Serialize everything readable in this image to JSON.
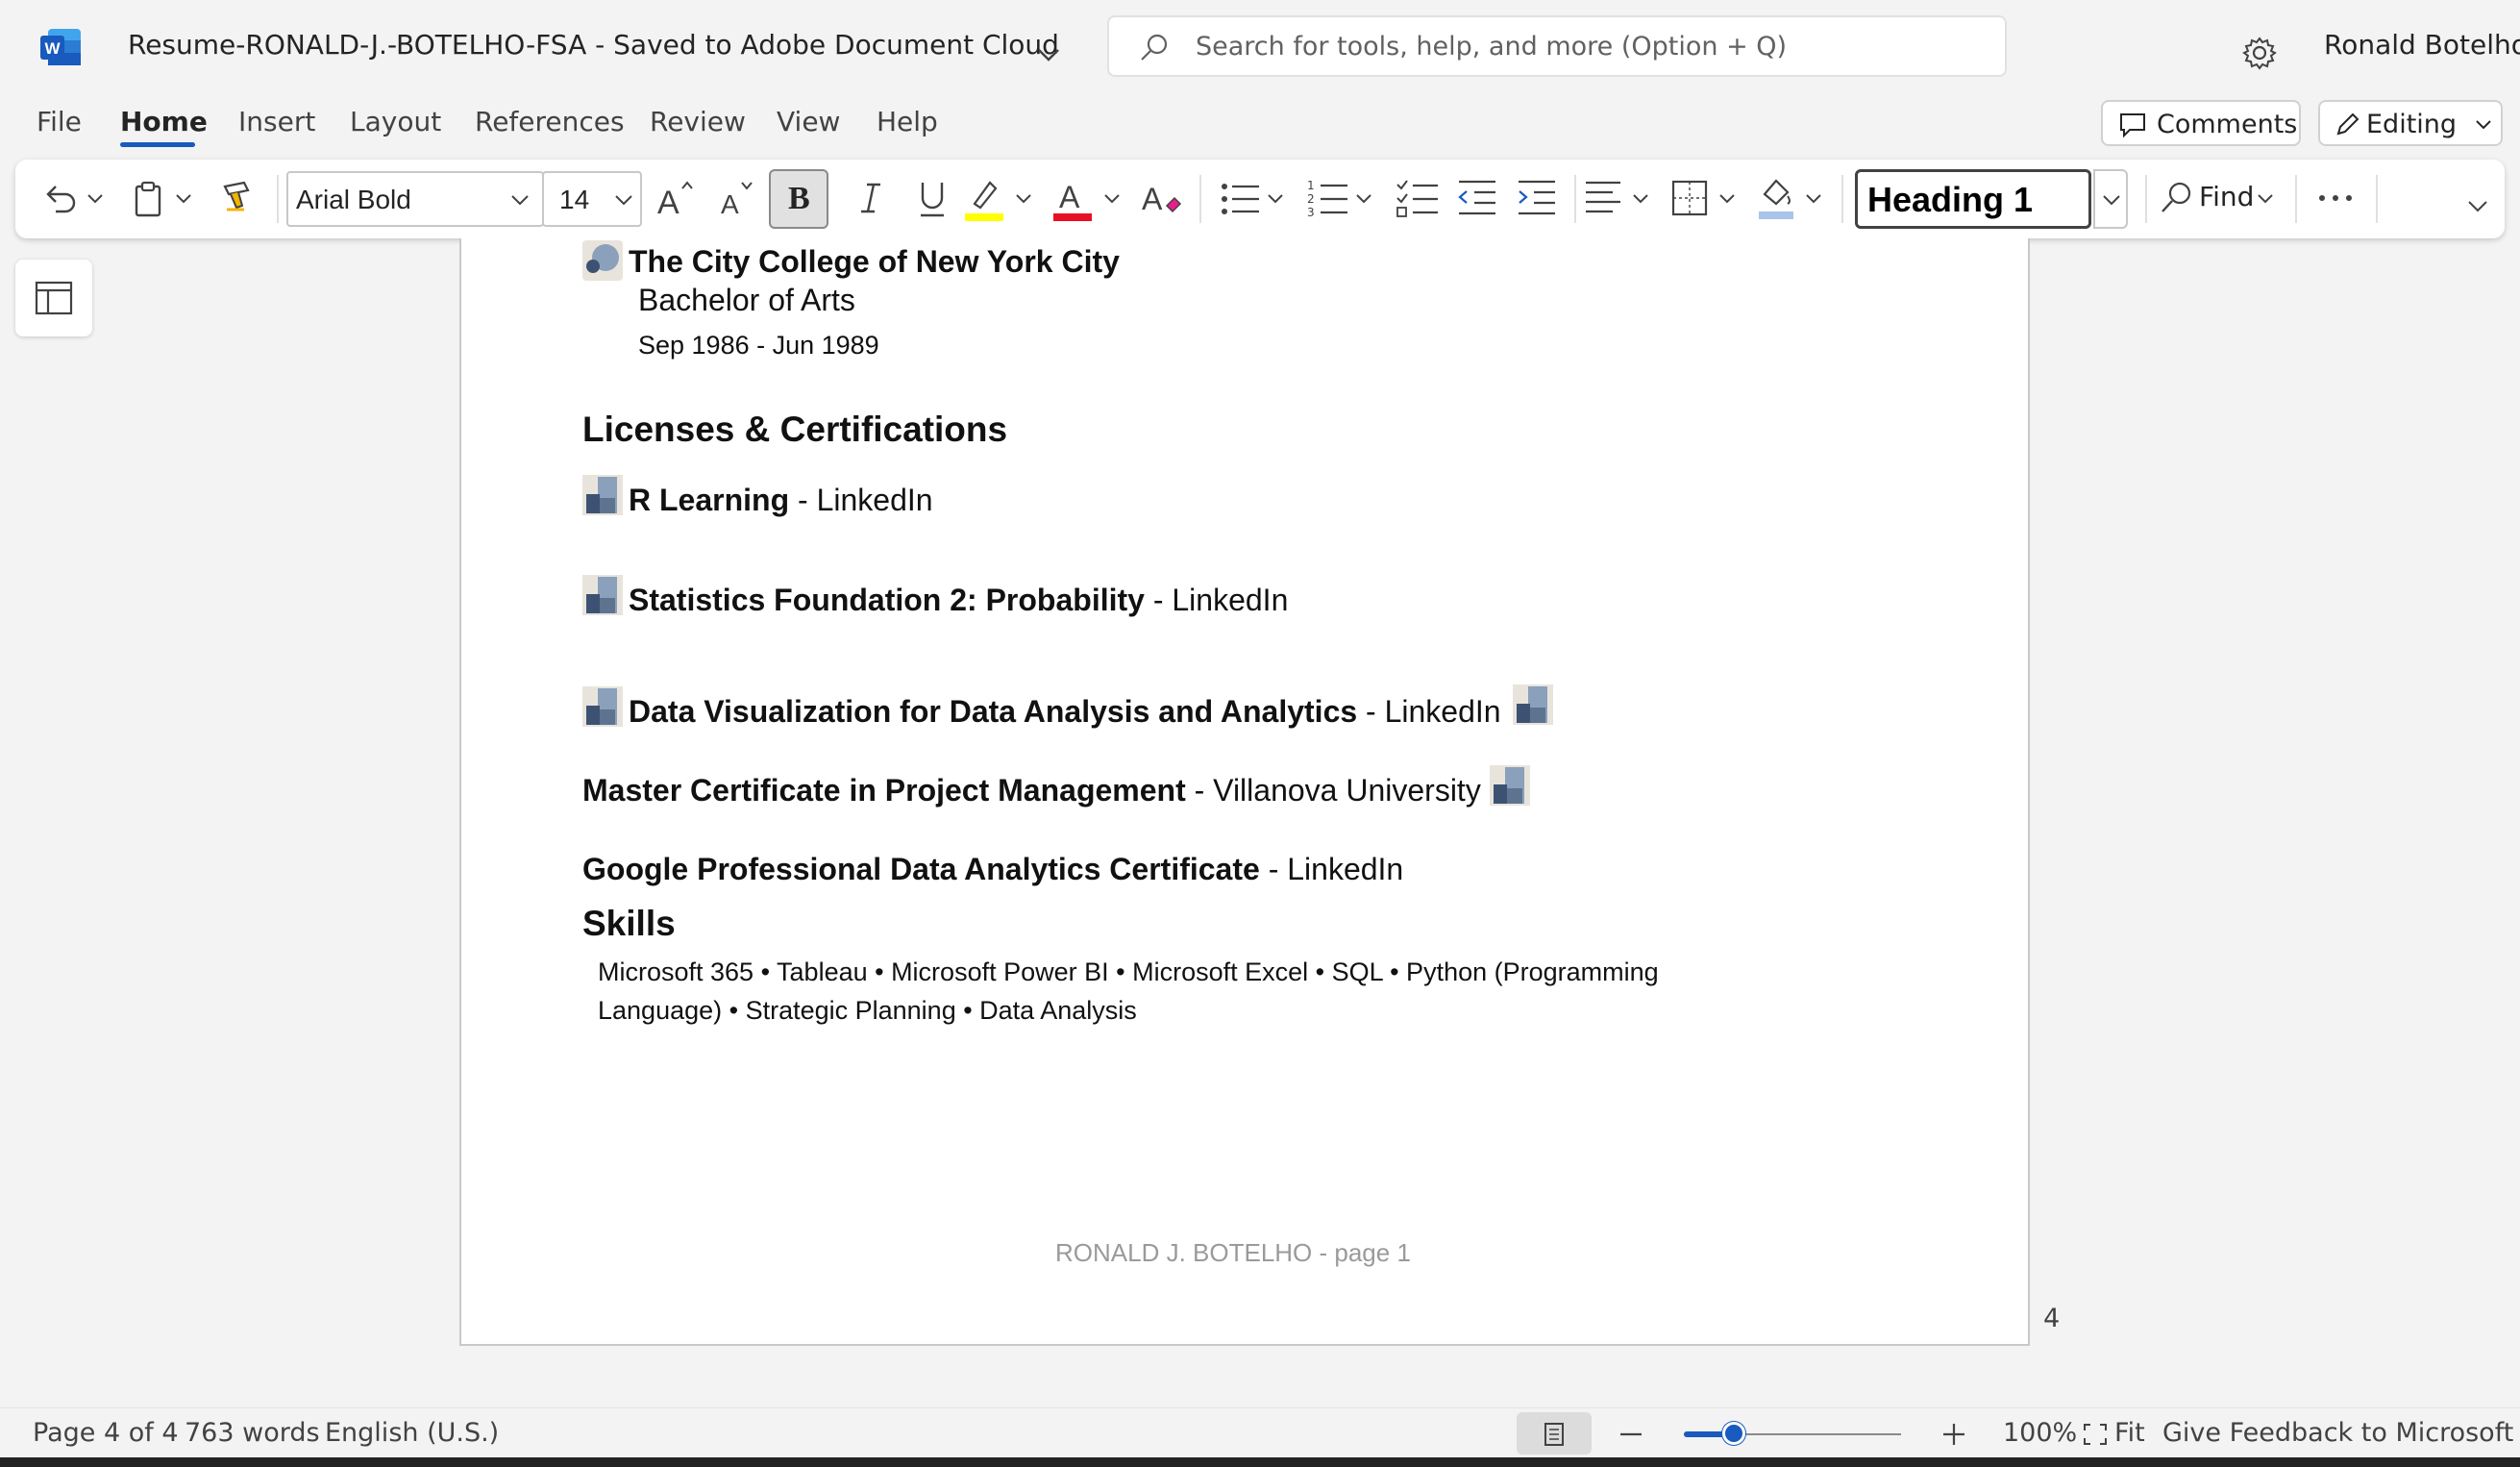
{
  "app": {
    "doc_title": "Resume-RONALD-J.-BOTELHO-FSA  -  Saved to Adobe Document Cloud",
    "search_placeholder": "Search for tools, help, and more (Option + Q)",
    "user_name": "Ronald Botelho"
  },
  "menu": {
    "tabs": [
      "File",
      "Home",
      "Insert",
      "Layout",
      "References",
      "Review",
      "View",
      "Help"
    ],
    "active_tab": "Home",
    "comments_label": "Comments",
    "editing_label": "Editing"
  },
  "ribbon": {
    "font_name": "Arial Bold",
    "font_size": "14",
    "bold_label": "B",
    "style_name": "Heading 1",
    "find_label": "Find",
    "highlight_color": "#ffff00",
    "font_color": "#e81123"
  },
  "document": {
    "edu_school": "The City College of New York City",
    "edu_degree": "Bachelor of Arts",
    "edu_dates": "Sep 1986 - Jun 1989",
    "licenses_heading": "Licenses & Certifications",
    "certs": [
      {
        "name": "R Learning",
        "issuer": " - LinkedIn"
      },
      {
        "name": "Statistics Foundation 2: Probability",
        "issuer": " - LinkedIn"
      },
      {
        "name": "Data Visualization for Data Analysis and Analytics",
        "issuer": " - LinkedIn"
      },
      {
        "name": "Master Certificate in Project Management",
        "issuer": " - Villanova University"
      },
      {
        "name": "Google Professional Data Analytics Certificate",
        "issuer": " - LinkedIn"
      }
    ],
    "skills_heading": "Skills",
    "skills_line1": "Microsoft 365 • Tableau • Microsoft Power BI • Microsoft Excel • SQL • Python (Programming",
    "skills_line2": "Language) • Strategic Planning • Data Analysis",
    "footer": "RONALD J. BOTELHO - page 1",
    "side_page_number": "4"
  },
  "status": {
    "page": "Page 4 of 4",
    "words": "763 words",
    "language": "English (U.S.)",
    "zoom": "100%",
    "zoom_level": 100,
    "fit": "Fit",
    "feedback": "Give Feedback to Microsoft"
  },
  "colors": {
    "accent": "#185abd",
    "word_brand": "#185abd"
  }
}
